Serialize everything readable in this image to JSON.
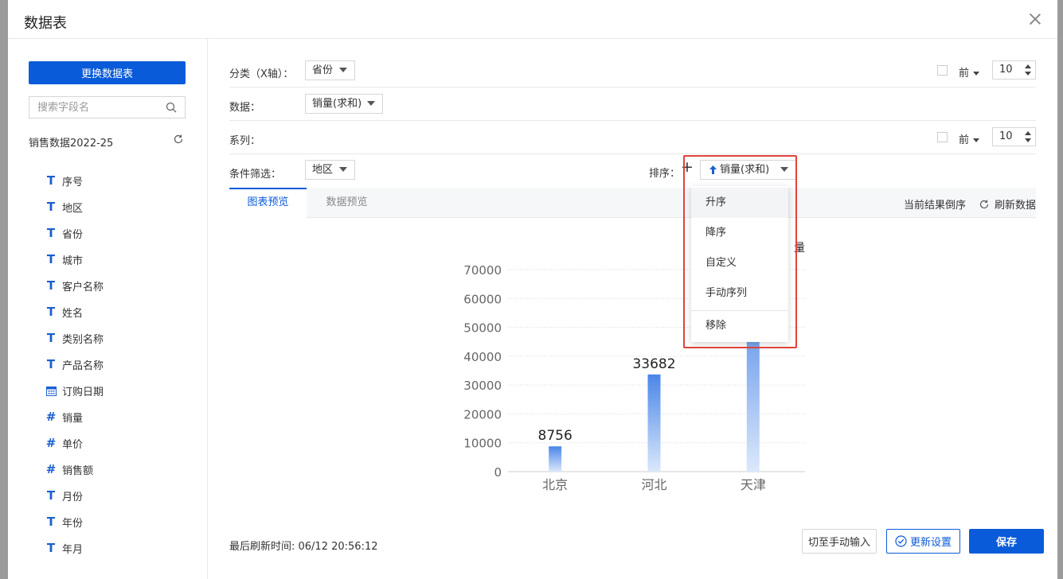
{
  "dialog": {
    "title": "数据表"
  },
  "sidebar": {
    "change_button": "更换数据表",
    "search_placeholder": "搜索字段名",
    "dataset_name": "销售数据2022-25",
    "fields": [
      {
        "label": "序号",
        "type": "text"
      },
      {
        "label": "地区",
        "type": "text"
      },
      {
        "label": "省份",
        "type": "text"
      },
      {
        "label": "城市",
        "type": "text"
      },
      {
        "label": "客户名称",
        "type": "text"
      },
      {
        "label": "姓名",
        "type": "text"
      },
      {
        "label": "类别名称",
        "type": "text"
      },
      {
        "label": "产品名称",
        "type": "text"
      },
      {
        "label": "订购日期",
        "type": "date"
      },
      {
        "label": "销量",
        "type": "number"
      },
      {
        "label": "单价",
        "type": "number"
      },
      {
        "label": "销售额",
        "type": "number"
      },
      {
        "label": "月份",
        "type": "text"
      },
      {
        "label": "年份",
        "type": "text"
      },
      {
        "label": "年月",
        "type": "text"
      }
    ]
  },
  "config": {
    "category_label": "分类（X轴）：",
    "category_value": "省份",
    "data_label": "数据：",
    "data_value": "销量(求和)",
    "series_label": "系列：",
    "filter_label": "条件筛选：",
    "filter_value": "地区",
    "top_label": "前",
    "top_value_1": "10",
    "top_value_2": "10",
    "sort_label": "排序：",
    "sort_plus": "+",
    "sort_value": "销量(求和)"
  },
  "tabs": {
    "chart_preview": "图表预览",
    "data_preview": "数据预览",
    "reverse": "当前结果倒序",
    "refresh": "刷新数据"
  },
  "chart_title_fragment": "量",
  "sort_menu": {
    "items": [
      "升序",
      "降序",
      "自定义",
      "手动序列"
    ],
    "remove": "移除"
  },
  "footer": {
    "last_refresh": "最后刷新时间: 06/12 20:56:12",
    "manual_input": "切至手动输入",
    "update_settings": "更新设置",
    "save": "保存"
  },
  "colors": {
    "primary": "#0a5bd9",
    "bar": "#4a86e8",
    "highlight": "#e0433b"
  },
  "chart_data": {
    "type": "bar",
    "categories": [
      "北京",
      "河北",
      "天津"
    ],
    "values": [
      8756,
      33682,
      65000
    ],
    "data_labels": [
      "8756",
      "33682",
      ""
    ],
    "ylim": [
      0,
      70000
    ],
    "yticks": [
      0,
      10000,
      20000,
      30000,
      40000,
      50000,
      60000,
      70000
    ],
    "grid": true
  }
}
